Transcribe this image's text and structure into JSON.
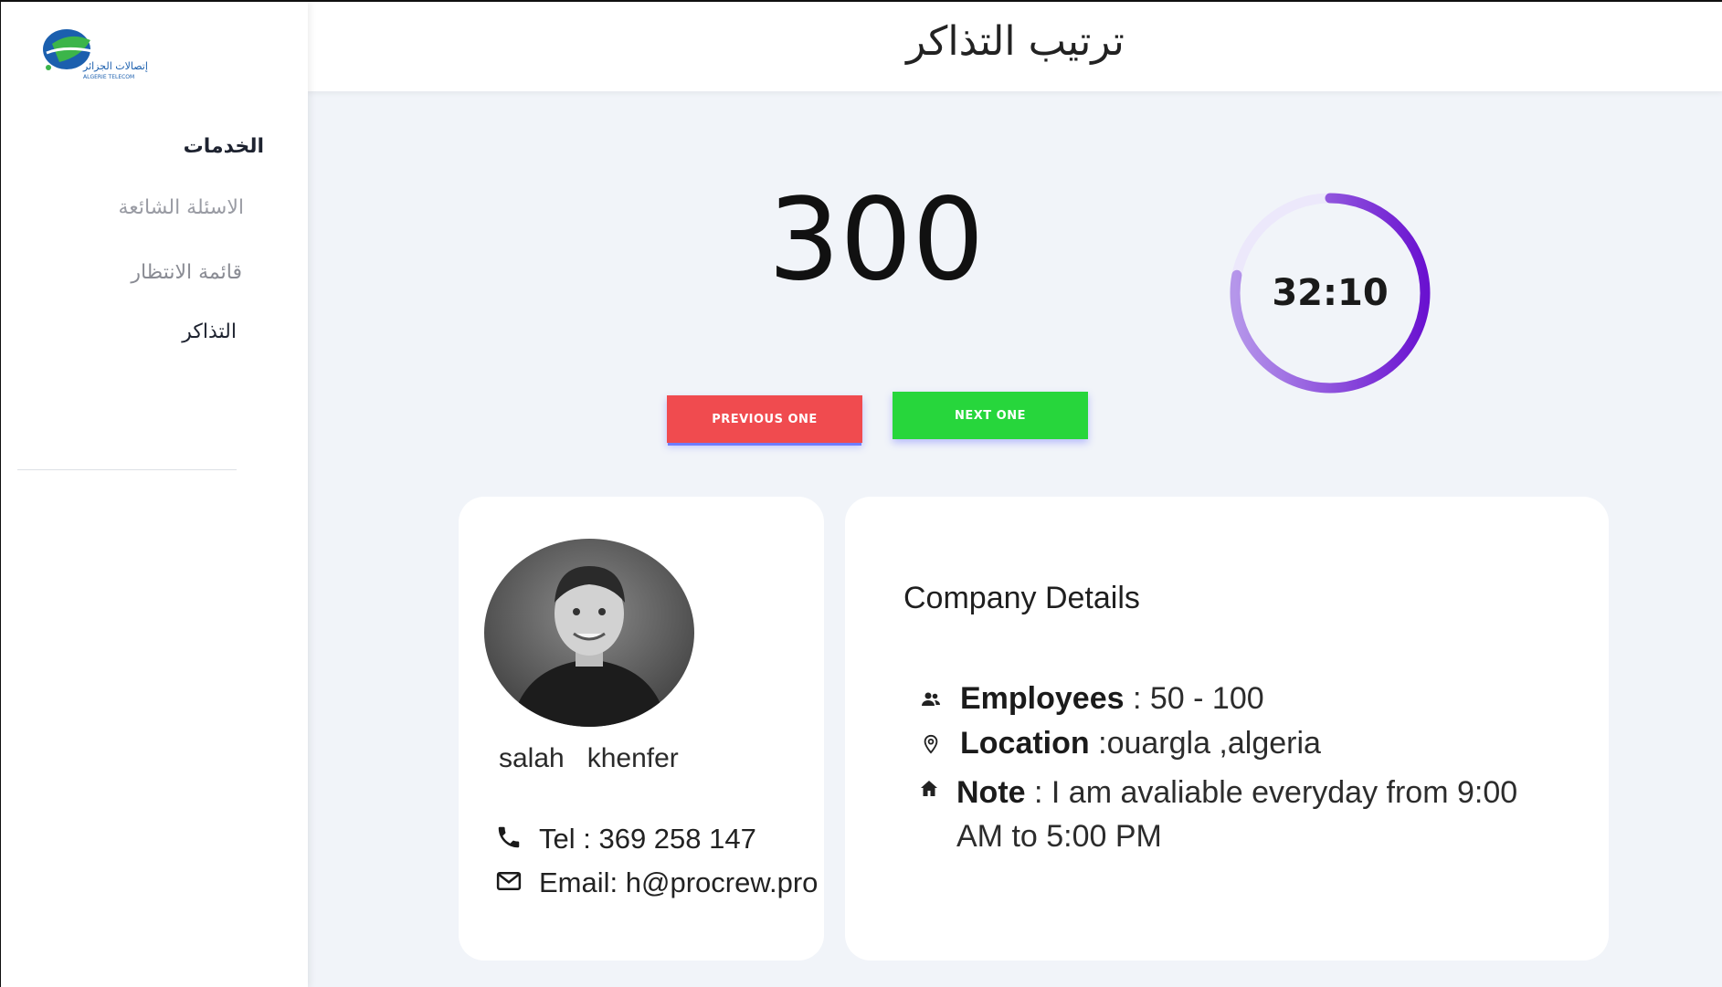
{
  "sidebar": {
    "logo_alt": "اتصالات الجزائر",
    "items": [
      {
        "label": "الخدمات"
      },
      {
        "label": "الاسئلة الشائعة"
      },
      {
        "label": "قائمة الانتظار"
      },
      {
        "label": "التذاكر"
      }
    ]
  },
  "header": {
    "title": "ترتيب التذاكر"
  },
  "ticket": {
    "number": "300"
  },
  "timer": {
    "value": "32:10",
    "progress": 0.78,
    "color": "#7a1fd6",
    "track_color": "#ece8fb"
  },
  "buttons": {
    "previous_label": "PREVIOUS ONE",
    "next_label": "NEXT ONE"
  },
  "profile": {
    "first_name": "salah",
    "last_name": "khenfer",
    "tel_label": "Tel : 369 258 147",
    "email_label": "Email: h@procrew.pro"
  },
  "company": {
    "title": "Company Details",
    "employees_label": "Employees",
    "employees_value": " : 50 - 100",
    "location_label": "Location",
    "location_value": " :ouargla  ,algeria",
    "note_label": "Note",
    "note_value": " : I am avaliable everyday from 9:00 AM to  5:00 PM"
  },
  "colors": {
    "prev_button": "#f04b4f",
    "next_button": "#27d63c",
    "background": "#f1f4f9"
  }
}
